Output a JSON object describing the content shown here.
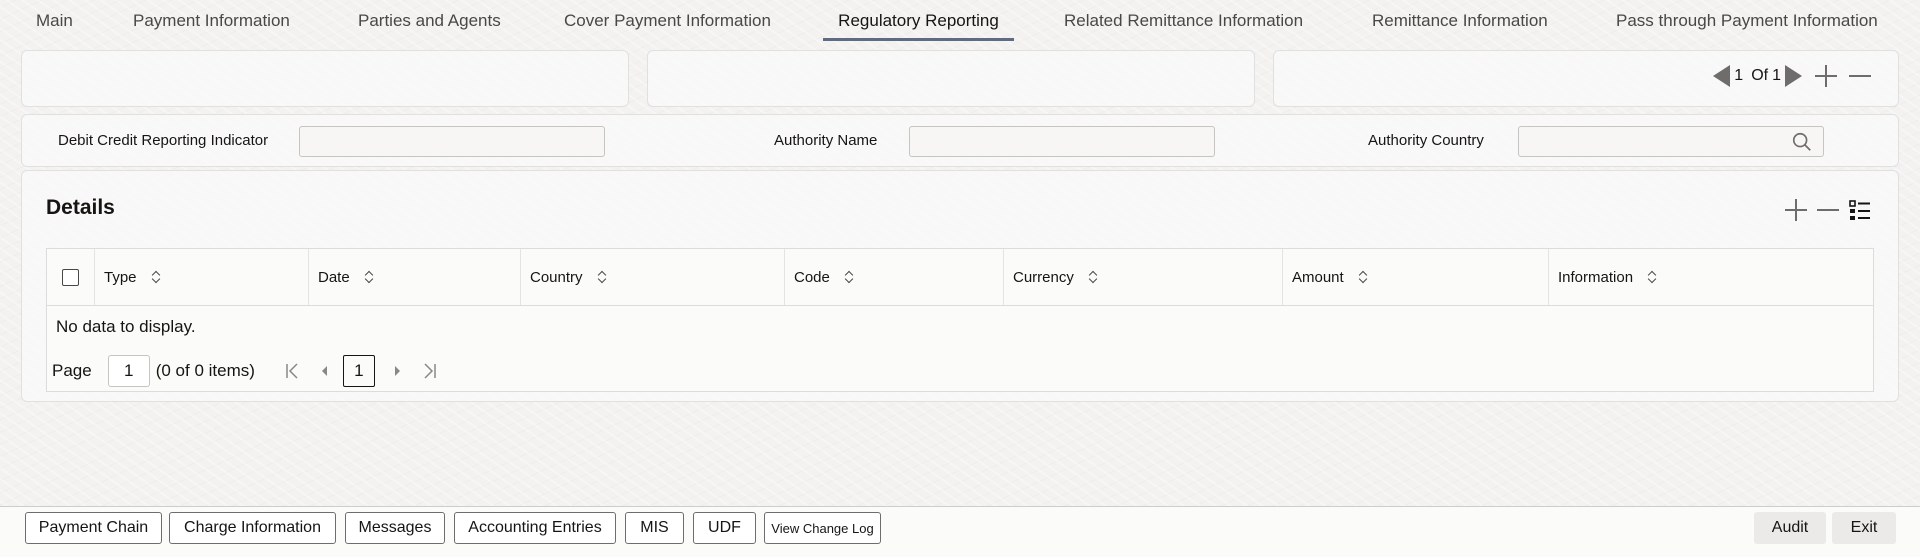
{
  "tabs": [
    {
      "label": "Main"
    },
    {
      "label": "Payment Information"
    },
    {
      "label": "Parties and Agents"
    },
    {
      "label": "Cover Payment Information"
    },
    {
      "label": "Regulatory Reporting",
      "active": true
    },
    {
      "label": "Related Remittance Information"
    },
    {
      "label": "Remittance Information"
    },
    {
      "label": "Pass through Payment Information"
    }
  ],
  "record_nav": {
    "current": "1",
    "of_label": "Of",
    "total": "1"
  },
  "fields": {
    "debit_credit_label": "Debit Credit Reporting Indicator",
    "debit_credit_value": "",
    "authority_name_label": "Authority Name",
    "authority_name_value": "",
    "authority_country_label": "Authority Country",
    "authority_country_value": ""
  },
  "details": {
    "title": "Details",
    "columns": [
      "Type",
      "Date",
      "Country",
      "Code",
      "Currency",
      "Amount",
      "Information"
    ],
    "empty_text": "No data to display.",
    "pager": {
      "page_label": "Page",
      "page_value": "1",
      "items_text": "(0 of 0 items)",
      "current_page": "1"
    }
  },
  "footer": {
    "left_buttons": [
      "Payment Chain",
      "Charge Information",
      "Messages",
      "Accounting Entries",
      "MIS",
      "UDF",
      "View Change Log"
    ],
    "right_buttons": [
      "Audit",
      "Exit"
    ]
  }
}
